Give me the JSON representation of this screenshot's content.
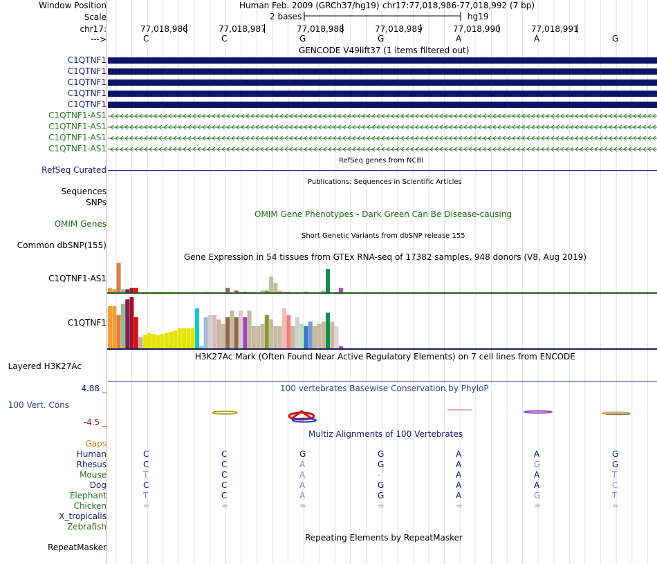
{
  "colors": {
    "gencode_coding": "#0c1466",
    "as1_green": "#2b7a2b",
    "navy_label": "#1a1a7a",
    "omim_green": "#1f6b1f",
    "phylop_blue": "#3a3a9a",
    "gaps_orange": "#d08000",
    "neg_red": "#8b1a1a",
    "divider": "#e0a0a0"
  },
  "header": {
    "window_position_label": "Window Position",
    "scale_label": "Scale",
    "chrom_label": "chr17:",
    "strand_label": "--->",
    "assembly": "Human Feb. 2009 (GRCh37/hg19)",
    "position": "chr17:77,018,986-77,018,992 (7 bp)",
    "scale_text": "2 bases",
    "scale_db": "hg19",
    "coordinates": [
      "77,018,986",
      "77,018,987",
      "77,018,988",
      "77,018,989",
      "77,018,990",
      "77,018,991"
    ],
    "bases": [
      "C",
      "C",
      "G",
      "G",
      "A",
      "A",
      "G"
    ]
  },
  "tracks": {
    "gencode_title": "GENCODE V49lift37 (1 items filtered out)",
    "gencode_genes": [
      "C1QTNF1",
      "C1QTNF1",
      "C1QTNF1",
      "C1QTNF1",
      "C1QTNF1"
    ],
    "gencode_antisense": [
      "C1QTNF1-AS1",
      "C1QTNF1-AS1",
      "C1QTNF1-AS1",
      "C1QTNF1-AS1"
    ],
    "refseq_label": "RefSeq Curated",
    "refseq_title": "RefSeq genes from NCBI",
    "pubs_title": "Publications: Sequences in Scientific Articles",
    "sequences_label": "Sequences",
    "snps_label": "SNPs",
    "omim_title": "OMIM Gene Phenotypes - Dark Green Can Be Disease-causing",
    "omim_label": "OMIM Genes",
    "dbsnp_title": "Short Genetic Variants from dbSNP release 155",
    "dbsnp_label": "Common dbSNP(155)",
    "gtex_title": "Gene Expression in 54 tissues from GTEx RNA-seq of 17382 samples, 948 donors (V8, Aug 2019)",
    "gtex_gene_as1": "C1QTNF1-AS1",
    "gtex_gene": "C1QTNF1",
    "h3k27_title": "H3K27Ac Mark (Often Found Near Active Regulatory Elements) on 7 cell lines from ENCODE",
    "h3k27_label": "Layered H3K27Ac",
    "phylop_title": "100 vertebrates Basewise Conservation by PhyloP",
    "phylop_label": "100 Vert. Cons",
    "phylop_max": "4.88 _",
    "phylop_min": "-4.5 _",
    "multiz_title": "Multiz Alignments of 100 Vertebrates",
    "gaps_label": "Gaps",
    "repeat_title": "Repeating Elements by RepeatMasker",
    "repeat_label": "RepeatMasker"
  },
  "multiz": {
    "species": [
      "Human",
      "Rhesus",
      "Mouse",
      "Dog",
      "Elephant",
      "Chicken",
      "X_tropicalis",
      "Zebrafish"
    ],
    "species_colors": [
      "#1a1a7a",
      "#1a1a7a",
      "#1f6b1f",
      "#1a1a7a",
      "#1f6b1f",
      "#1f6b1f",
      "#1a1a7a",
      "#1f6b1f"
    ],
    "rows": [
      [
        "C",
        "C",
        "G",
        "G",
        "A",
        "A",
        "G"
      ],
      [
        "C",
        "C",
        "A",
        "G",
        "A",
        "G",
        "G"
      ],
      [
        "T",
        "C",
        "A",
        "-",
        "A",
        "A",
        "T"
      ],
      [
        "C",
        "C",
        "A",
        "G",
        "A",
        "A",
        "C"
      ],
      [
        "T",
        "C",
        "A",
        "G",
        "A",
        "G",
        "T"
      ],
      [
        "=",
        "=",
        "=",
        "=",
        "=",
        "=",
        "="
      ],
      [],
      []
    ]
  },
  "gtex": {
    "as1_values": [
      4,
      3,
      24,
      3,
      3,
      4,
      4,
      0,
      1,
      0,
      1,
      1,
      1,
      1,
      1,
      0,
      1,
      0,
      0,
      0,
      0,
      0,
      1,
      0,
      0,
      0,
      0,
      4,
      0,
      2,
      1,
      1,
      1,
      1,
      0,
      2,
      2,
      13,
      8,
      2,
      1,
      1,
      0,
      1,
      0,
      1,
      0,
      0,
      0,
      2,
      19,
      0,
      1,
      4
    ],
    "gene_values": [
      38,
      38,
      30,
      40,
      44,
      46,
      28,
      10,
      12,
      14,
      13,
      12,
      13,
      14,
      15,
      16,
      18,
      18,
      18,
      18,
      36,
      2,
      28,
      30,
      30,
      26,
      22,
      28,
      34,
      28,
      34,
      28,
      34,
      20,
      20,
      22,
      30,
      26,
      20,
      20,
      36,
      30,
      20,
      28,
      22,
      20,
      24,
      20,
      22,
      24,
      32,
      24,
      20,
      2
    ],
    "colors": [
      "#f2a03c",
      "#f0a030",
      "#e07e42",
      "#8fbd8c",
      "#7a1f4f",
      "#a80f2a",
      "#d81010",
      "#c4b0a2",
      "#e4e40a",
      "#e4e40a",
      "#e4e40a",
      "#e4e40a",
      "#e4e40a",
      "#e4e40a",
      "#e4e40a",
      "#e4e40a",
      "#e4e40a",
      "#e4e40a",
      "#e4e40a",
      "#e4e40a",
      "#13c8d0",
      "#6ec8e0",
      "#a0bcd0",
      "#cfcfcf",
      "#d8b8b8",
      "#c8b8a0",
      "#c8b8a0",
      "#8a6a4a",
      "#c8b8a0",
      "#8a6a4a",
      "#e0c8c8",
      "#9a48b8",
      "#c8b8a0",
      "#c8b8a0",
      "#c8b8a0",
      "#c8b8a0",
      "#8a9a30",
      "#c8b8a0",
      "#c8b8a0",
      "#c8b8a0",
      "#f8b8b8",
      "#f08080",
      "#c8b8a0",
      "#d0d0d0",
      "#b8e0b8",
      "#3878d0",
      "#7898d0",
      "#c8b8a0",
      "#c8b8a0",
      "#c8b8a0",
      "#109048",
      "#c8b8a0",
      "#e8d0d0",
      "#c040c0"
    ]
  }
}
